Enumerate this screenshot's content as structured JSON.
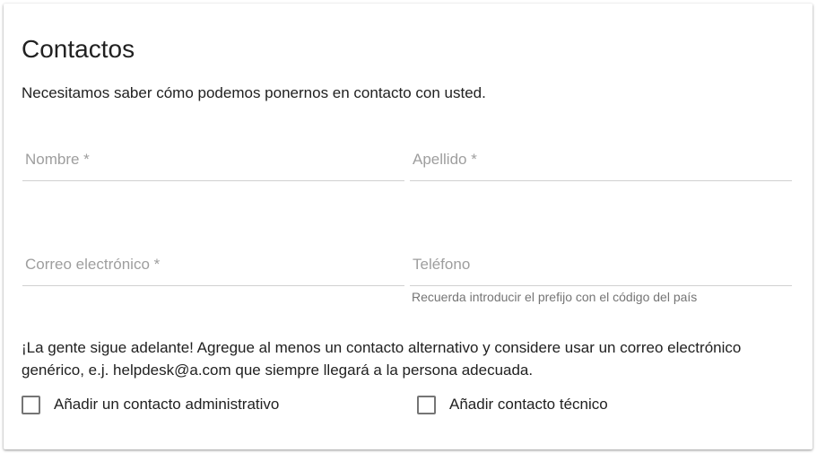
{
  "form": {
    "title": "Contactos",
    "intro": "Necesitamos saber cómo podemos ponernos en contacto con usted.",
    "fields": {
      "first_name": {
        "placeholder": "Nombre *",
        "value": ""
      },
      "last_name": {
        "placeholder": "Apellido *",
        "value": ""
      },
      "email": {
        "placeholder": "Correo electrónico *",
        "value": ""
      },
      "phone": {
        "placeholder": "Teléfono",
        "value": "",
        "hint": "Recuerda introducir el prefijo con el código del país"
      }
    },
    "notice": "¡La gente sigue adelante! Agregue al menos un contacto alternativo y considere usar un correo electrónico genérico, e.j. helpdesk@a.com que siempre llegará a la persona adecuada.",
    "checkboxes": {
      "admin_contact": {
        "label": "Añadir un contacto administrativo",
        "checked": false
      },
      "tech_contact": {
        "label": "Añadir contacto técnico",
        "checked": false
      }
    }
  },
  "colors": {
    "text": "#212121",
    "placeholder": "#9e9e9e",
    "hint": "#757575",
    "underline": "#d0d0d0",
    "checkbox_border": "#757575"
  }
}
